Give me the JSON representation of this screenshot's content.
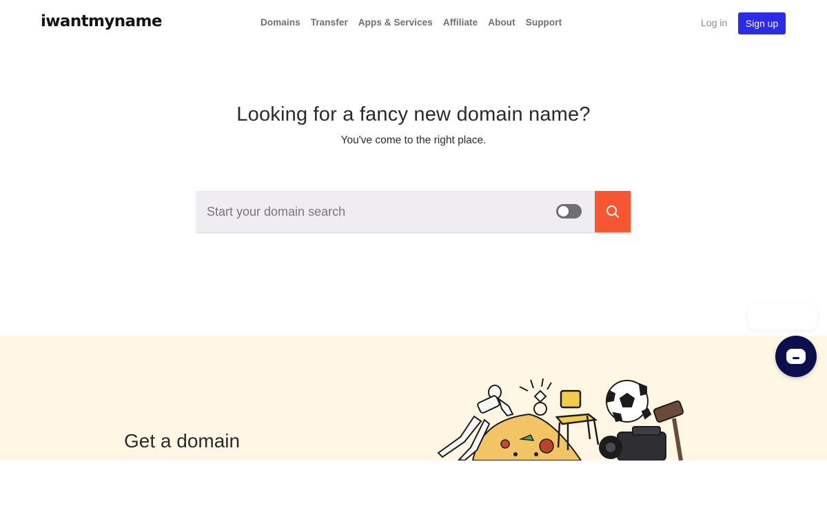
{
  "header": {
    "logo": "iwantmyname",
    "nav": [
      "Domains",
      "Transfer",
      "Apps & Services",
      "Affiliate",
      "About",
      "Support"
    ],
    "login_label": "Log in",
    "signup_label": "Sign up"
  },
  "hero": {
    "title": "Looking for a fancy new domain name?",
    "subtitle": "You've come to the right place."
  },
  "search": {
    "placeholder": "Start your domain search",
    "value": "",
    "toggle_on": false,
    "button_icon": "search-icon"
  },
  "band": {
    "title": "Get a domain",
    "illustration": "collage-illustration"
  },
  "chat": {
    "icon": "chat-icon"
  },
  "colors": {
    "accent": "#2c2bea",
    "search_button": "#f65631",
    "band_background": "#fff7e3",
    "chat_button": "#0b0f4d"
  }
}
